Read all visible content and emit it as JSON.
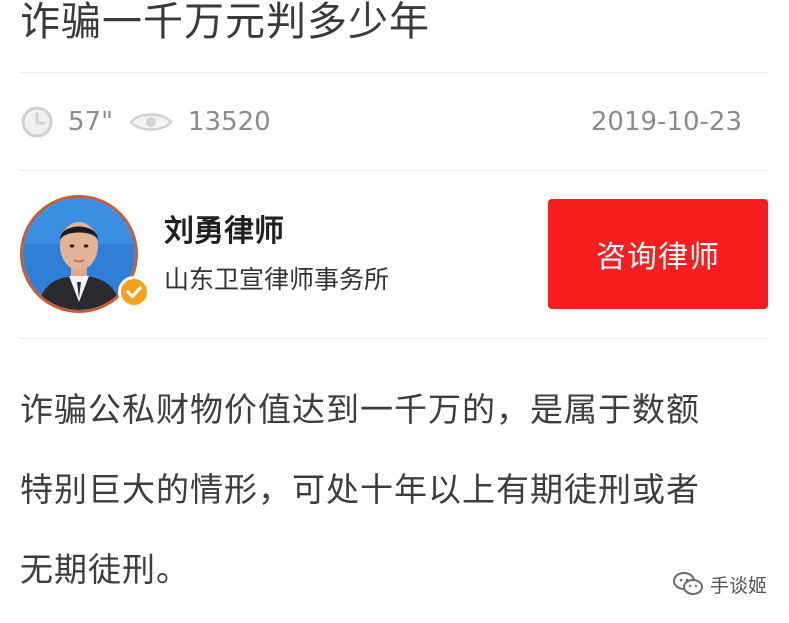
{
  "article": {
    "title": "诈骗一千万元判多少年",
    "meta": {
      "icons": {
        "duration": "clock-icon",
        "views": "eye-icon"
      },
      "duration": "57\"",
      "views": "13520",
      "date": "2019-10-23"
    },
    "body": [
      "诈骗公私财物价值达到一千万的，是属于数额",
      "特别巨大的情形，可处十年以上有期徒刑或者",
      "无期徒刑。"
    ]
  },
  "lawyer": {
    "name": "刘勇律师",
    "firm": "山东卫宣律师事务所",
    "verified_icon": "check-badge-icon",
    "avatar_icon": "avatar"
  },
  "actions": {
    "consult_label": "咨询律师"
  },
  "watermark": {
    "text": "手谈姬",
    "icon": "wechat-icon"
  },
  "colors": {
    "accent": "#f61e1e",
    "meta_text": "#8c8c8c",
    "badge": "#f3a21d"
  }
}
